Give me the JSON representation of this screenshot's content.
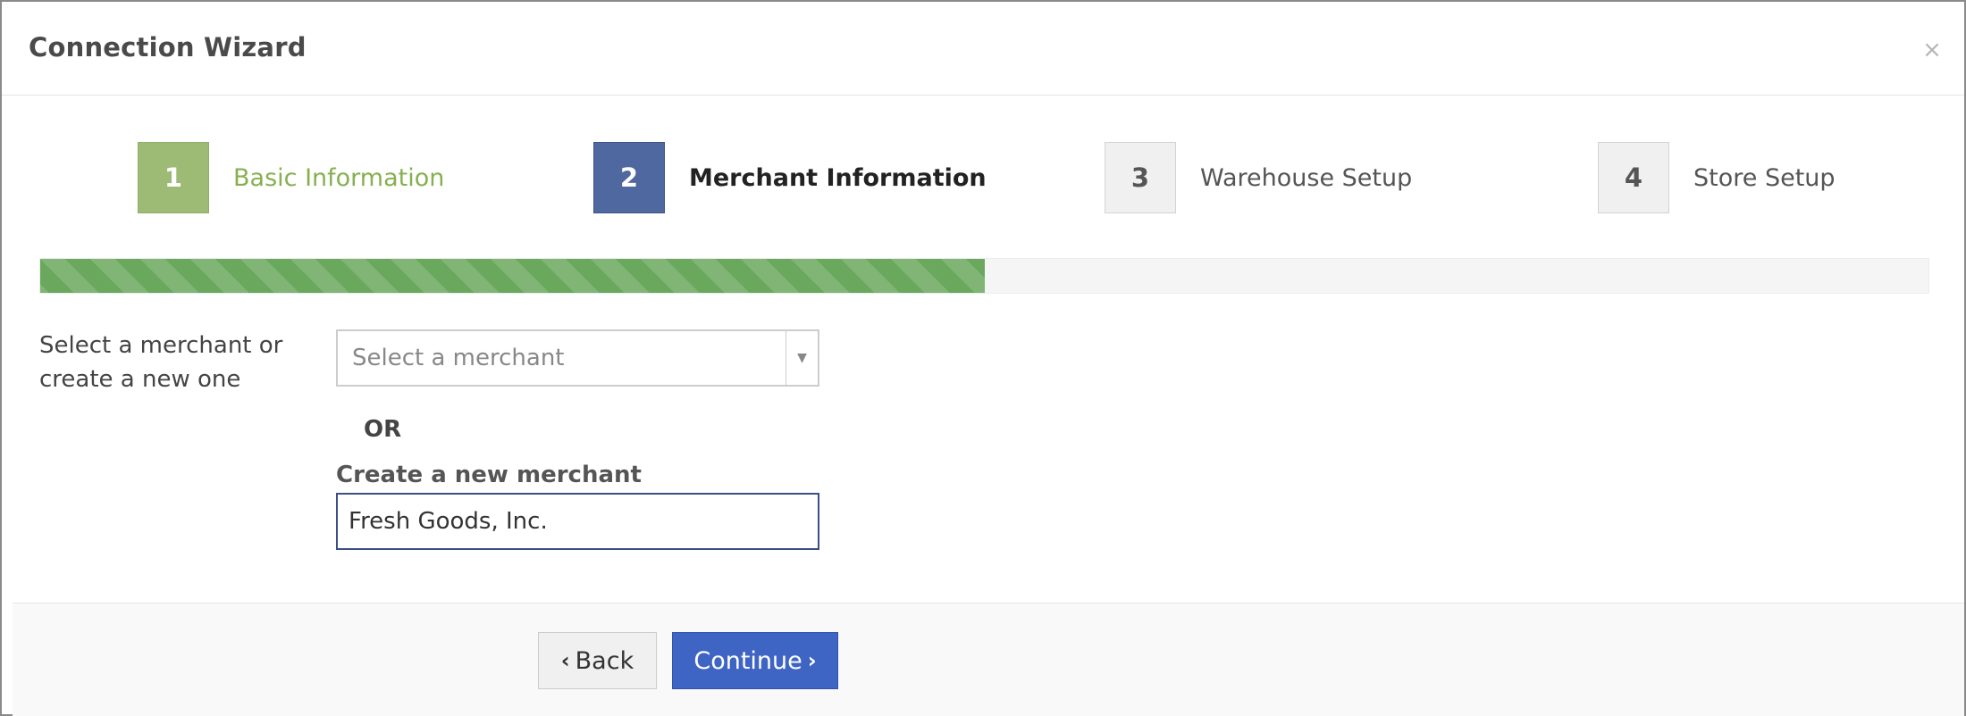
{
  "modal": {
    "title": "Connection Wizard",
    "close_symbol": "×"
  },
  "steps": [
    {
      "number": "1",
      "label": "Basic Information",
      "state": "done"
    },
    {
      "number": "2",
      "label": "Merchant Information",
      "state": "active"
    },
    {
      "number": "3",
      "label": "Warehouse Setup",
      "state": "todo"
    },
    {
      "number": "4",
      "label": "Store Setup",
      "state": "todo"
    }
  ],
  "progress": {
    "percent": 50,
    "color": "#6aa85e"
  },
  "form": {
    "merchant_label": "Select a merchant or create a new one",
    "select_placeholder": "Select a merchant",
    "or_label": "OR",
    "new_merchant_label": "Create a new merchant",
    "new_merchant_value": "Fresh Goods, Inc."
  },
  "footer": {
    "back_label": "Back",
    "continue_label": "Continue"
  },
  "icons": {
    "close": "close-icon",
    "select_arrow": "caret-down-icon",
    "back": "chevron-left-icon",
    "continue": "chevron-right-icon"
  },
  "colors": {
    "done": "#9dbb75",
    "active": "#5068a0",
    "primary_button": "#3e64c4"
  }
}
